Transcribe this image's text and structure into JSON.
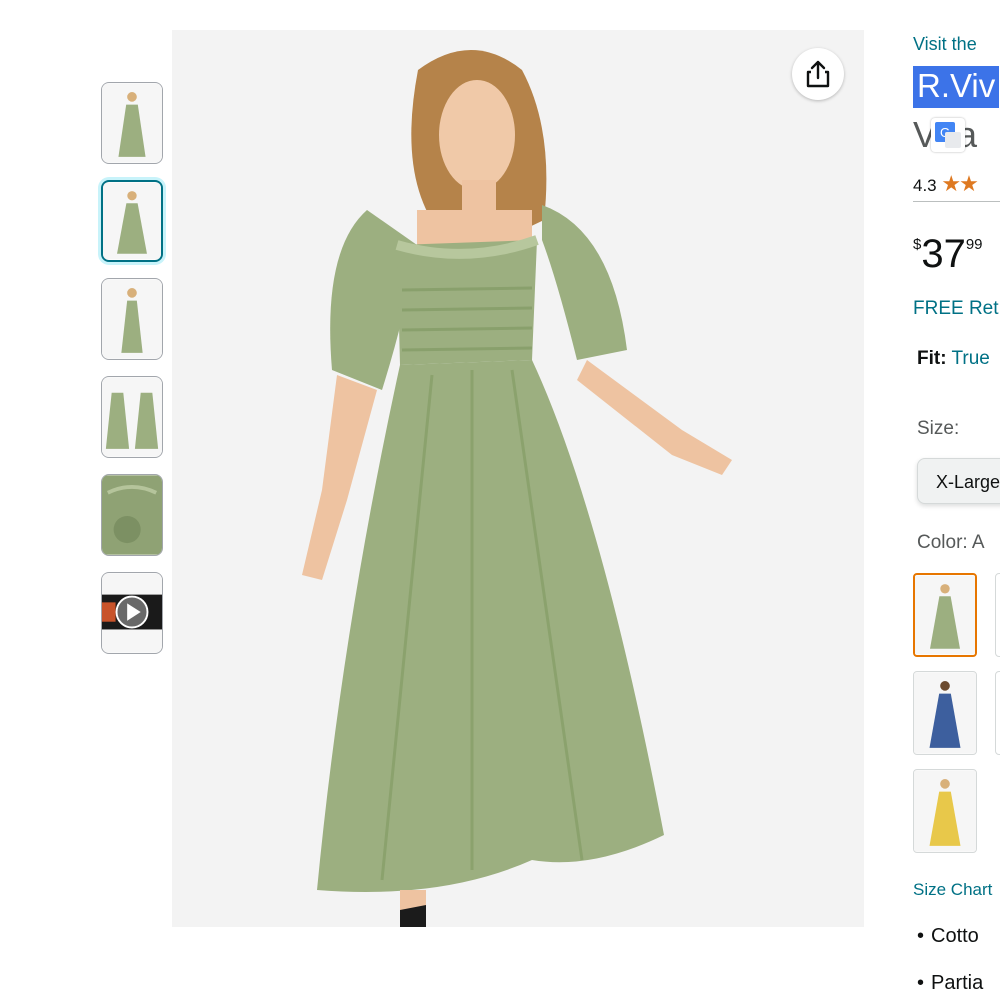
{
  "product": {
    "visit_store": "Visit the",
    "brand_title": "R.Viv",
    "title_line2": "V   ta",
    "rating": "4.3",
    "stars": "★★",
    "price_symbol": "$",
    "price_whole": "37",
    "price_fraction": "99",
    "free_returns": "FREE Ret",
    "fit_label": "Fit:",
    "fit_value": "True",
    "size_label": "Size:",
    "size_selected": "X-Large",
    "color_label": "Color: A",
    "size_chart": "Size Chart",
    "bullets": [
      "Cotto",
      "Partia"
    ]
  },
  "colors": {
    "dress_green": "#9caf80",
    "dress_blue": "#3d5f9e",
    "dress_yellow": "#e8c84a",
    "link": "#007185",
    "selected_thumb": "#007185",
    "selected_swatch": "#e77600",
    "star": "#de7921",
    "highlight": "#3c73e8"
  },
  "icons": {
    "share": "share-icon",
    "play": "play-icon",
    "translate": "translate-icon"
  }
}
